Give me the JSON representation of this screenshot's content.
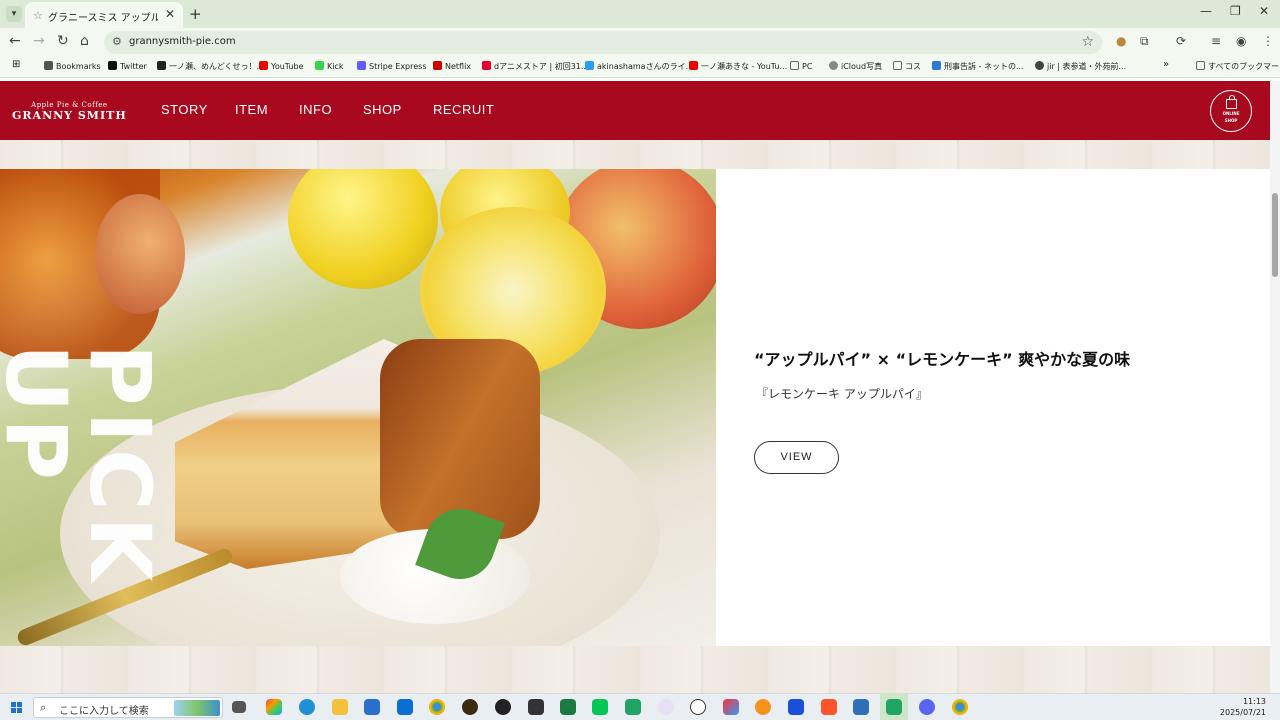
{
  "browser": {
    "tab_title": "グラニースミス アップルパイ & コーヒー",
    "url": "grannysmith-pie.com",
    "bookmarks": [
      {
        "label": "Bookmarks",
        "color": "#555"
      },
      {
        "label": "Twitter",
        "color": "#111"
      },
      {
        "label": "一ノ瀬、めんどくせっ！...",
        "color": "#222"
      },
      {
        "label": "YouTube",
        "color": "#e00"
      },
      {
        "label": "Kick",
        "color": "#3bd14b"
      },
      {
        "label": "Stripe Express",
        "color": "#635bff"
      },
      {
        "label": "Netflix",
        "color": "#c00"
      },
      {
        "label": "dアニメストア | 初回31...",
        "color": "#e4002b"
      },
      {
        "label": "akinashamaさんのライ...",
        "color": "#2a9df4"
      },
      {
        "label": "一ノ瀬あきな - YouTu...",
        "color": "#e00"
      },
      {
        "label": "PC",
        "color": "#666"
      },
      {
        "label": "iCloud写真",
        "color": "#888"
      },
      {
        "label": "コス",
        "color": "#666"
      },
      {
        "label": "刑事告訴 - ネットの...",
        "color": "#2b7bd6"
      },
      {
        "label": "jir | 表参道・外苑前...",
        "color": "#444"
      }
    ],
    "all_bookmarks": "すべてのブックマーク"
  },
  "site": {
    "logo_sub": "Apple Pie & Coffee",
    "logo_main": "GRANNY SMITH",
    "nav": [
      "STORY",
      "ITEM",
      "INFO",
      "SHOP",
      "RECRUIT"
    ],
    "online_shop": [
      "ONLINE",
      "SHOP"
    ]
  },
  "pickup": {
    "vertical_label": "PICK UP",
    "headline": "“アップルパイ” × “レモンケーキ” 爽やかな夏の味",
    "subtitle": "『レモンケーキ アップルパイ』",
    "view_label": "VIEW"
  },
  "taskbar": {
    "search_placeholder": "ここに入力して検索",
    "time": "11:13",
    "date": "2025/07/21"
  }
}
